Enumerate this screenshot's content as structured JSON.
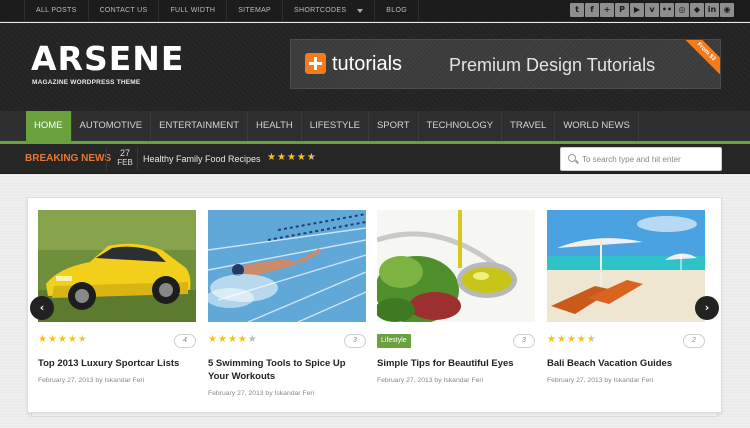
{
  "top_nav": [
    {
      "label": "ALL POSTS"
    },
    {
      "label": "CONTACT US"
    },
    {
      "label": "FULL WIDTH"
    },
    {
      "label": "SITEMAP"
    },
    {
      "label": "SHORTCODES"
    },
    {
      "label": "BLOG"
    }
  ],
  "social": [
    {
      "icon": "twitter-icon",
      "glyph": "t"
    },
    {
      "icon": "facebook-icon",
      "glyph": "f"
    },
    {
      "icon": "google-plus-icon",
      "glyph": "+"
    },
    {
      "icon": "pinterest-icon",
      "glyph": "P"
    },
    {
      "icon": "youtube-icon",
      "glyph": "▶"
    },
    {
      "icon": "vimeo-icon",
      "glyph": "v"
    },
    {
      "icon": "flickr-icon",
      "glyph": "••"
    },
    {
      "icon": "dribbble-icon",
      "glyph": "◎"
    },
    {
      "icon": "delicious-icon",
      "glyph": "◆"
    },
    {
      "icon": "linkedin-icon",
      "glyph": "in"
    },
    {
      "icon": "rss-icon",
      "glyph": "◉"
    }
  ],
  "logo": {
    "title": "ARSENE",
    "tagline": "MAGAZINE WORDPRESS THEME"
  },
  "banner": {
    "brand": "tutorials",
    "subtitle": "Premium Design Tutorials",
    "ribbon": "From $3"
  },
  "main_nav": [
    {
      "label": "HOME",
      "active": true
    },
    {
      "label": "AUTOMOTIVE"
    },
    {
      "label": "ENTERTAINMENT"
    },
    {
      "label": "HEALTH"
    },
    {
      "label": "LIFESTYLE"
    },
    {
      "label": "SPORT"
    },
    {
      "label": "TECHNOLOGY"
    },
    {
      "label": "TRAVEL"
    },
    {
      "label": "WORLD NEWS"
    }
  ],
  "breaking": {
    "label": "BREAKING NEWS",
    "day": "27",
    "month": "FEB",
    "title": "Healthy Family Food Recipes",
    "rating": 4.5
  },
  "search": {
    "placeholder": "To search type and hit enter"
  },
  "cards": [
    {
      "title": "Top 2013 Luxury Sportcar Lists",
      "meta": "February 27, 2013 by Iskandar Feri",
      "comments": "4",
      "rating": 4.5,
      "badge": ""
    },
    {
      "title": "5 Swimming Tools to Spice Up Your Workouts",
      "meta": "February 27, 2013 by Iskandar Feri",
      "comments": "3",
      "rating": 4,
      "badge": ""
    },
    {
      "title": "Simple Tips for Beautiful Eyes",
      "meta": "February 27, 2013 by Iskandar Feri",
      "comments": "3",
      "rating": 0,
      "badge": "Lifestyle"
    },
    {
      "title": "Bali Beach Vacation Guides",
      "meta": "February 27, 2013 by Iskandar Feri",
      "comments": "2",
      "rating": 4.5,
      "badge": ""
    }
  ],
  "slider": {
    "prev_glyph": "‹",
    "next_glyph": "›"
  },
  "colors": {
    "accent_green": "#6aa13c",
    "breaking_orange": "#e87635",
    "star_gold": "#f4c21c",
    "banner_orange": "#f47a20"
  }
}
